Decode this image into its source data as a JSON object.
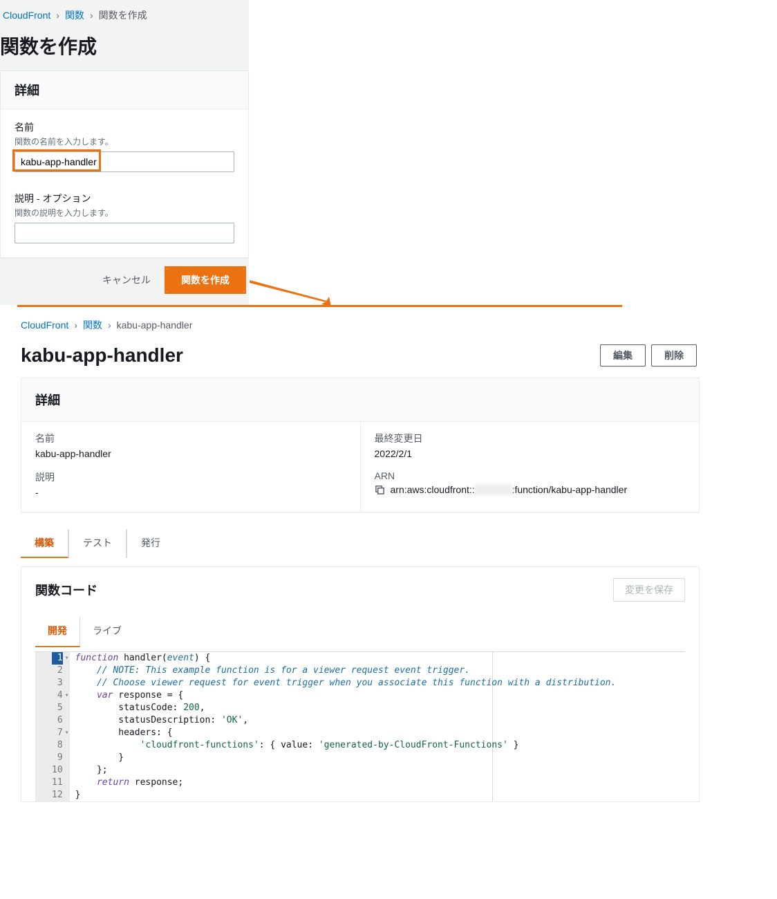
{
  "top": {
    "breadcrumb": {
      "root": "CloudFront",
      "section": "関数",
      "current": "関数を作成"
    },
    "page_title": "関数を作成",
    "panel_header": "詳細",
    "name": {
      "label": "名前",
      "hint": "関数の名前を入力します。",
      "value": "kabu-app-handler"
    },
    "desc": {
      "label": "説明 - オプション",
      "hint": "関数の説明を入力します。",
      "value": ""
    },
    "actions": {
      "cancel": "キャンセル",
      "create": "関数を作成"
    }
  },
  "bottom": {
    "breadcrumb": {
      "root": "CloudFront",
      "section": "関数",
      "current": "kabu-app-handler"
    },
    "page_title": "kabu-app-handler",
    "actions": {
      "edit": "編集",
      "delete": "削除"
    },
    "detail": {
      "header": "詳細",
      "name_label": "名前",
      "name_value": "kabu-app-handler",
      "desc_label": "説明",
      "desc_value": "-",
      "updated_label": "最終変更日",
      "updated_value": "2022/2/1",
      "arn_label": "ARN",
      "arn_prefix": "arn:aws:cloudfront::",
      "arn_suffix": ":function/kabu-app-handler"
    },
    "tabs": {
      "build": "構築",
      "test": "テスト",
      "publish": "発行"
    },
    "code": {
      "header": "関数コード",
      "save": "変更を保存",
      "subtabs": {
        "dev": "開発",
        "live": "ライブ"
      },
      "lines": [
        {
          "n": 1,
          "fold": true,
          "hl": true
        },
        {
          "n": 2
        },
        {
          "n": 3
        },
        {
          "n": 4,
          "fold": true
        },
        {
          "n": 5
        },
        {
          "n": 6
        },
        {
          "n": 7,
          "fold": true
        },
        {
          "n": 8
        },
        {
          "n": 9
        },
        {
          "n": 10
        },
        {
          "n": 11
        },
        {
          "n": 12
        }
      ],
      "src": {
        "l1a": "function",
        "l1b": " handler(",
        "l1c": "event",
        "l1d": ") {",
        "l2": "    // NOTE: This example function is for a viewer request event trigger.",
        "l3": "    // Choose viewer request for event trigger when you associate this function with a distribution.",
        "l4a": "    ",
        "l4b": "var",
        "l4c": " response = {",
        "l5a": "        statusCode: ",
        "l5b": "200",
        "l5c": ",",
        "l6a": "        statusDescription: ",
        "l6b": "'OK'",
        "l6c": ",",
        "l7": "        headers: {",
        "l8a": "            ",
        "l8b": "'cloudfront-functions'",
        "l8c": ": { value: ",
        "l8d": "'generated-by-CloudFront-Functions'",
        "l8e": " }",
        "l9": "        }",
        "l10": "    };",
        "l11a": "    ",
        "l11b": "return",
        "l11c": " response;",
        "l12": "}"
      }
    }
  }
}
